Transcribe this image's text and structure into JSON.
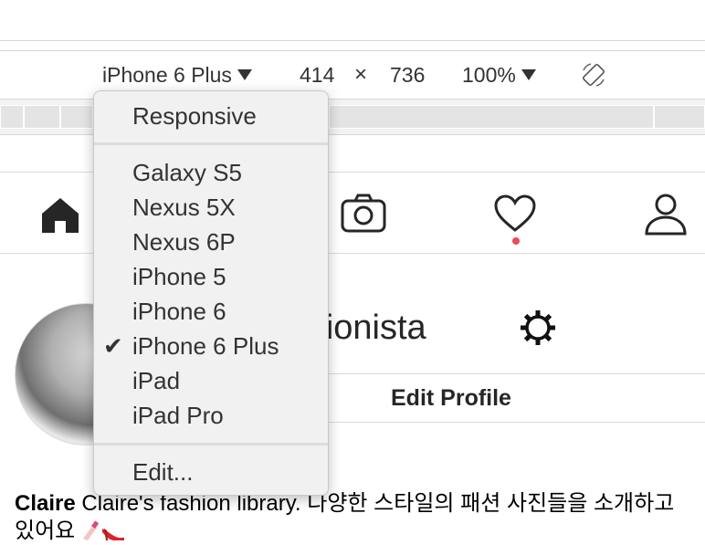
{
  "device_toolbar": {
    "device": "iPhone 6 Plus",
    "width": "414",
    "times": "×",
    "height": "736",
    "zoom": "100%"
  },
  "device_menu": {
    "group1": [
      "Responsive"
    ],
    "group2": [
      "Galaxy S5",
      "Nexus 5X",
      "Nexus 6P",
      "iPhone 5",
      "iPhone 6",
      "iPhone 6 Plus",
      "iPad",
      "iPad Pro"
    ],
    "checked": "iPhone 6 Plus",
    "check_mark": "✔",
    "edit": "Edit..."
  },
  "profile": {
    "username": "fashionista",
    "edit_profile": "Edit Profile",
    "bio_name": "Claire",
    "bio_text": " Claire's fashion library. 다양한 스타일의 패션 사진들을 소개하고 있어요"
  },
  "colors": {
    "notification_dot": "#ed4956",
    "menu_bg": "#f1f1f1"
  }
}
